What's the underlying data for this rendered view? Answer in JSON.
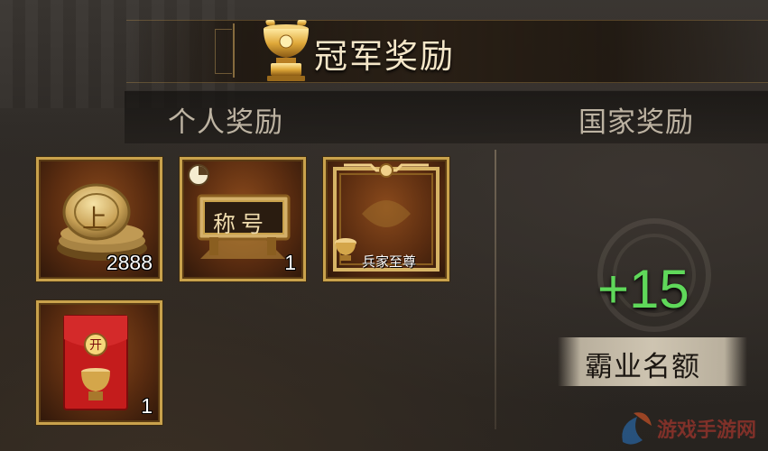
{
  "header": {
    "title": "冠军奖励",
    "icon": "golden-cauldron-icon"
  },
  "tabs": [
    {
      "label": "个人奖励"
    },
    {
      "label": "国家奖励"
    }
  ],
  "personal_rewards": [
    {
      "name": "coin-stack",
      "icon": "coin-上",
      "coin_char": "上",
      "count": "2888"
    },
    {
      "name": "title-plaque",
      "icon": "title-plaque",
      "plaque_text": "称号",
      "count": "1",
      "badge": "timer-icon"
    },
    {
      "name": "frame",
      "icon": "ornate-frame",
      "caption": "兵家至尊",
      "count": ""
    },
    {
      "name": "red-envelope",
      "icon": "red-envelope",
      "envelope_char": "开",
      "count": "1"
    }
  ],
  "national_rewards": {
    "bonus": "+15",
    "label": "霸业名额"
  },
  "watermark": {
    "text": "游戏手游网"
  },
  "colors": {
    "gold_border": "#c9a24c",
    "bonus_green": "#5fd85a",
    "title_text": "#f4e6c8",
    "tab_text": "#bdb3a2"
  }
}
